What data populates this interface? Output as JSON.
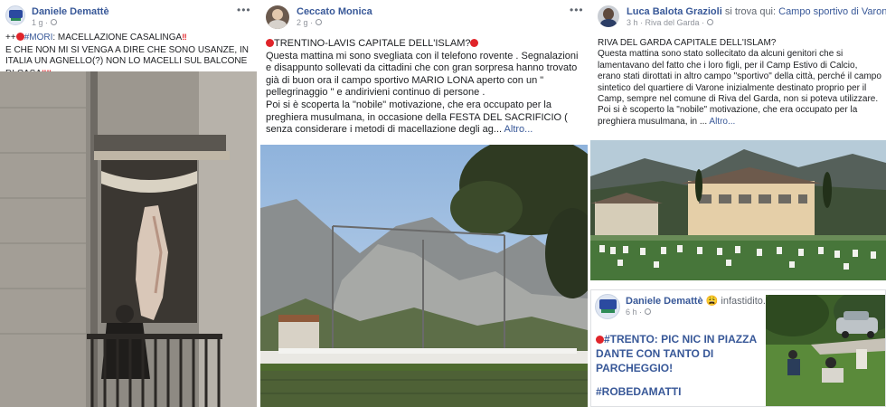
{
  "post1": {
    "author": "Daniele Demattè",
    "time": "1 g",
    "line1_prefix": "++",
    "hashtag": "#MORI",
    "line1_text": ": MACELLAZIONE CASALINGA",
    "line1_suffix": "‼",
    "body": "E CHE NON MI SI VENGA A DIRE CHE SONO USANZE, IN ITALIA UN AGNELLO(?) NON LO MACELLI SUL BALCONE DI CASA",
    "body_suffix": "‼‼"
  },
  "post2": {
    "author": "Ceccato Monica",
    "time": "2 g",
    "title": "TRENTINO-LAVIS CAPITALE DELL'ISLAM?",
    "p1": "Questa mattina mi sono svegliata con il telefono rovente . Segnalazioni e disappunto sollevati da cittadini che con gran sorpresa hanno trovato già di buon ora il campo sportivo MARIO LONA aperto con un \" pellegrinaggio \" e andirivieni continuo di persone .",
    "p2": "Poi si è scoperta la \"nobile\" motivazione, che era occupato per la preghiera musulmana, in occasione della FESTA DEL SACRIFICIO ( senza considerare i metodi di macellazione degli ag...",
    "more": "Altro..."
  },
  "post3": {
    "author": "Luca Balota Grazioli",
    "location_prefix": "si trova qui:",
    "location": "Campo sportivo di Varone.",
    "time": "3 h",
    "place": "Riva del Garda",
    "title": "RIVA DEL GARDA CAPITALE DELL'ISLAM?",
    "p1": "Questa mattina sono stato sollecitato da alcuni genitori che si lamentavano del fatto che i loro figli, per il Camp Estivo di Calcio, erano stati dirottati in altro campo \"sportivo\" della città, perché il campo sintetico del quartiere di Varone inizialmente destinato proprio per il Camp, sempre nel comune di Riva del Garda, non si poteva utilizzare.",
    "p2": "Poi si è scoperto la \"nobile\" motivazione, che era occupato per la preghiera musulmana, in ...",
    "more": "Altro..."
  },
  "post4": {
    "author": "Daniele Demattè",
    "feeling_emoji": "😩",
    "feeling": "infastidito.",
    "time": "6 h",
    "hashtag": "#TRENTO",
    "text": ": PIC NIC IN PIAZZA DANTE CON TANTO DI PARCHEGGIO!",
    "hashtag2": "#ROBEDAMATTI"
  },
  "ui": {
    "more_options": "•••"
  },
  "colors": {
    "link": "#385898",
    "meta": "#90949c",
    "alert_red": "#e0242a"
  }
}
